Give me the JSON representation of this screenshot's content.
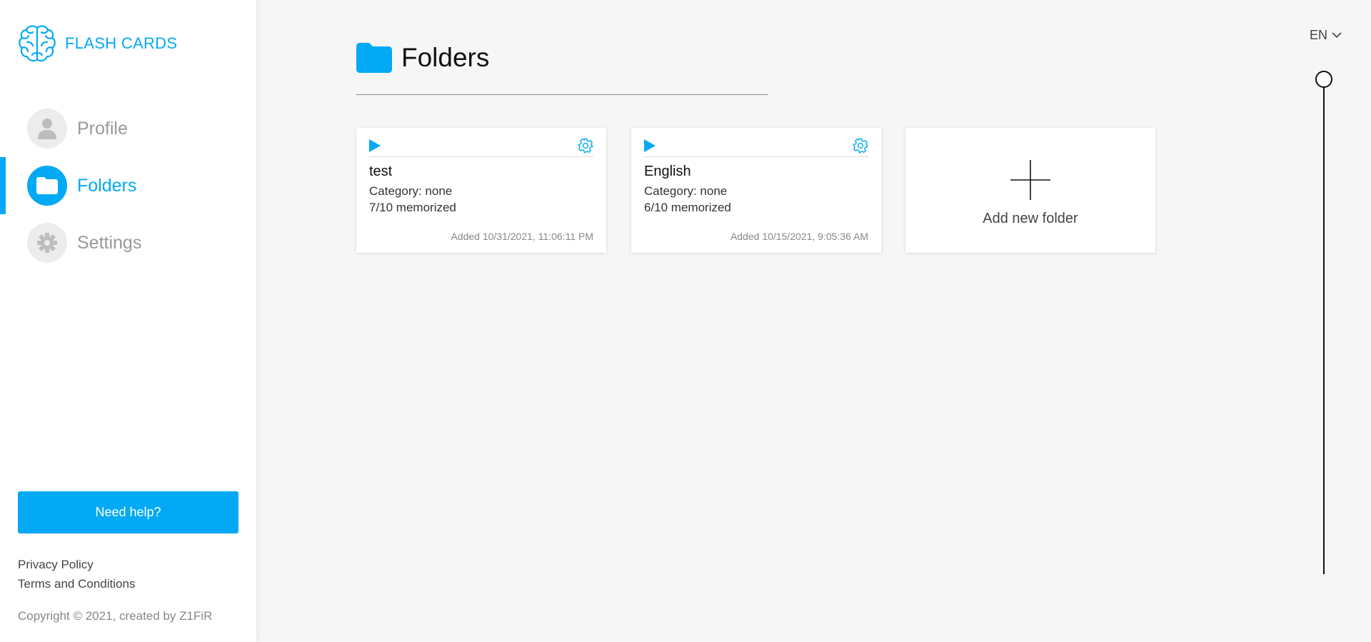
{
  "app": {
    "name": "FLASH CARDS"
  },
  "sidebar": {
    "items": [
      {
        "label": "Profile",
        "icon": "person-icon",
        "active": false
      },
      {
        "label": "Folders",
        "icon": "folder-icon",
        "active": true
      },
      {
        "label": "Settings",
        "icon": "gear-icon",
        "active": false
      }
    ],
    "help_label": "Need help?",
    "links": [
      "Privacy Policy",
      "Terms and Conditions"
    ],
    "copyright": "Copyright © 2021, created by Z1FiR"
  },
  "main": {
    "title": "Folders",
    "folders": [
      {
        "name": "test",
        "category": "Category: none",
        "memorized": "7/10 memorized",
        "added": "Added 10/31/2021, 11:06:11 PM"
      },
      {
        "name": "English",
        "category": "Category: none",
        "memorized": "6/10 memorized",
        "added": "Added 10/15/2021, 9:05:36 AM"
      }
    ],
    "add_label": "Add new folder"
  },
  "language": {
    "selected": "EN"
  },
  "colors": {
    "accent": "#03a9f4",
    "background": "#f6f6f6",
    "sidebar": "#ffffff"
  }
}
